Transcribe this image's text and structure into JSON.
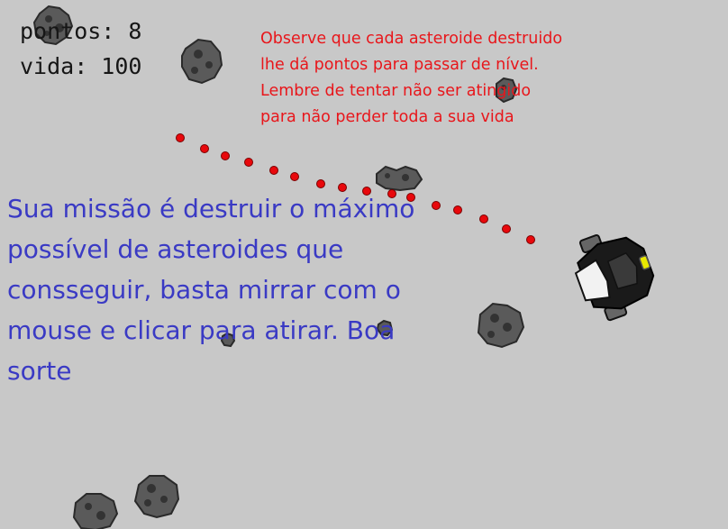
{
  "hud": {
    "score_label": "pontos: 8",
    "life_label": "vida: 100"
  },
  "hint": {
    "lines": [
      "Observe que cada asteroide destruido",
      "lhe dá pontos para passar de nível.",
      "Lembre de tentar não ser atingido",
      "para não perder toda a sua vida"
    ],
    "color": "#e8161b"
  },
  "mission": {
    "lines": [
      "Sua missão é destruir o máximo",
      "possível de asteroides que",
      "consseguir, basta mirrar com o",
      "mouse e clicar para atirar. Boa",
      "sorte"
    ],
    "color": "#3a3ac4"
  },
  "colors": {
    "background": "#c8c8c8",
    "bullet": "#e8080c",
    "asteroid": "#5a5a5a",
    "ship_accent": "#e8e800"
  },
  "icons": {
    "asteroid": "asteroid-sprite",
    "bullet": "bullet-dot",
    "ship": "spaceship-sprite"
  }
}
